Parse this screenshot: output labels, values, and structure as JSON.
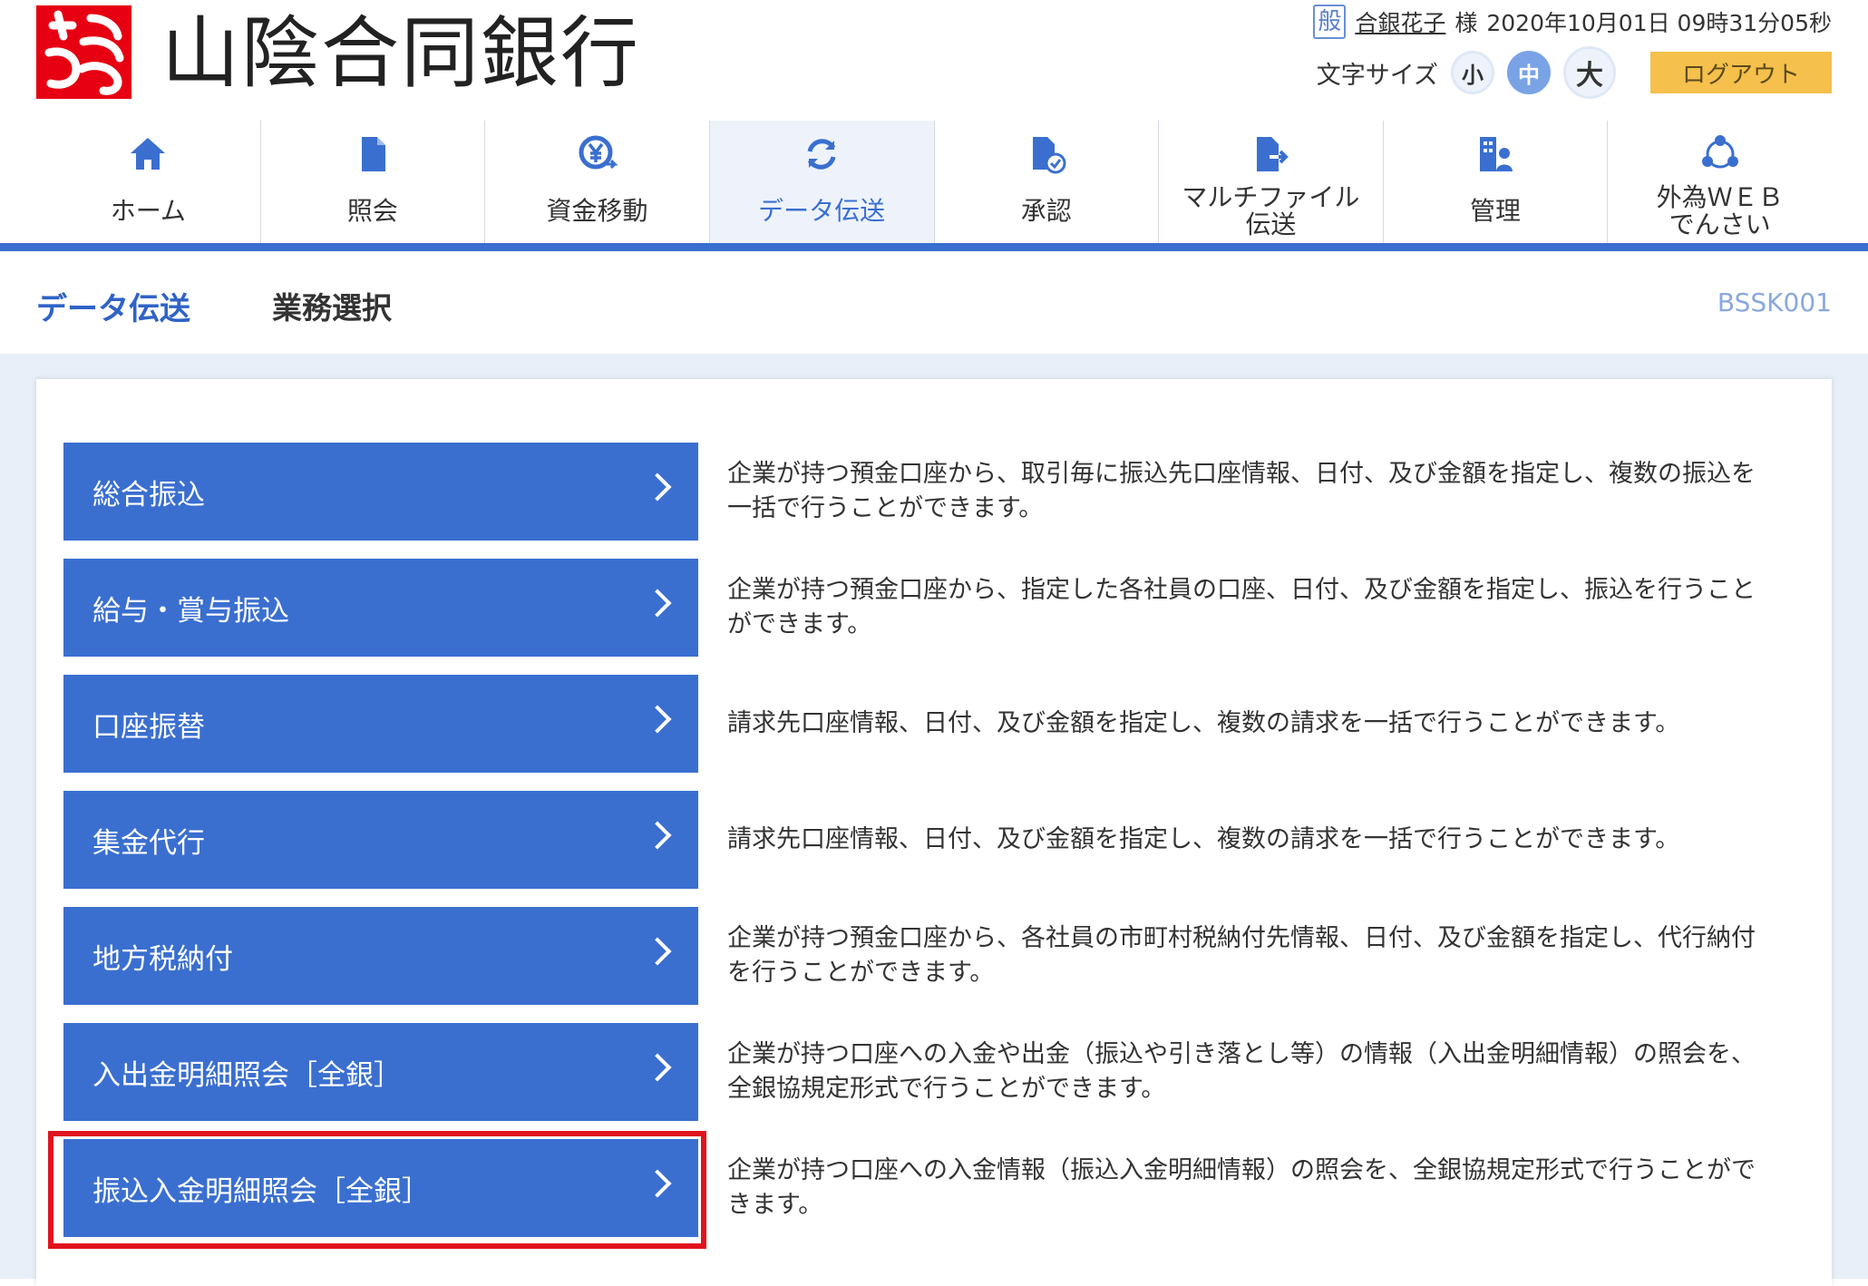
{
  "header": {
    "bank_name": "山陰合同銀行",
    "user_kind": "般",
    "user_name": "合銀花子",
    "honorific": "様",
    "datetime": "2020年10月01日 09時31分05秒",
    "font_size_label": "文字サイズ",
    "font_sizes": {
      "small": "小",
      "medium": "中",
      "large": "大"
    },
    "logout_label": "ログアウト"
  },
  "nav": {
    "items": [
      {
        "label": "ホーム",
        "icon": "home-icon"
      },
      {
        "label": "照会",
        "icon": "document-icon"
      },
      {
        "label": "資金移動",
        "icon": "yen-transfer-icon"
      },
      {
        "label": "データ伝送",
        "icon": "sync-icon"
      },
      {
        "label": "承認",
        "icon": "approval-icon"
      },
      {
        "label": "マルチファイル\n伝送",
        "icon": "file-send-icon"
      },
      {
        "label": "管理",
        "icon": "admin-icon"
      },
      {
        "label": "外為ＷＥＢ\nでんさい",
        "icon": "network-icon"
      }
    ],
    "active": "データ伝送"
  },
  "title": {
    "main": "データ伝送",
    "sub": "業務選択",
    "screen_id": "BSSK001"
  },
  "menu": [
    {
      "label": "総合振込",
      "desc": "企業が持つ預金口座から、取引毎に振込先口座情報、日付、及び金額を指定し、複数の振込を一括で行うことができます。"
    },
    {
      "label": "給与・賞与振込",
      "desc": "企業が持つ預金口座から、指定した各社員の口座、日付、及び金額を指定し、振込を行うことができます。"
    },
    {
      "label": "口座振替",
      "desc": "請求先口座情報、日付、及び金額を指定し、複数の請求を一括で行うことができます。"
    },
    {
      "label": "集金代行",
      "desc": "請求先口座情報、日付、及び金額を指定し、複数の請求を一括で行うことができます。"
    },
    {
      "label": "地方税納付",
      "desc": "企業が持つ預金口座から、各社員の市町村税納付先情報、日付、及び金額を指定し、代行納付を行うことができます。"
    },
    {
      "label": "入出金明細照会［全銀］",
      "desc": "企業が持つ口座への入金や出金（振込や引き落とし等）の情報（入出金明細情報）の照会を、全銀協規定形式で行うことができます。"
    },
    {
      "label": "振込入金明細照会［全銀］",
      "desc": "企業が持つ口座への入金情報（振込入金明細情報）の照会を、全銀協規定形式で行うことができます。"
    }
  ],
  "colors": {
    "accent": "#3a6fd0",
    "logout": "#f5c04c",
    "highlight": "#e0141e",
    "logo": "#e60012"
  }
}
